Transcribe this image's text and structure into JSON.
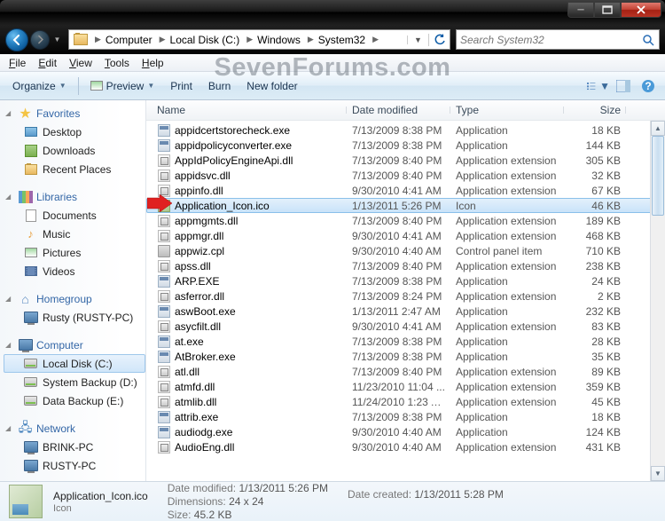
{
  "window": {
    "min": "_",
    "max": "❐",
    "close_title": "Close"
  },
  "nav": {
    "crumbs": [
      "Computer",
      "Local Disk (C:)",
      "Windows",
      "System32"
    ],
    "search_placeholder": "Search System32"
  },
  "menu": {
    "file": "File",
    "edit": "Edit",
    "view": "View",
    "tools": "Tools",
    "help": "Help"
  },
  "watermark": "SevenForums.com",
  "toolbar": {
    "organize": "Organize",
    "preview": "Preview",
    "print": "Print",
    "burn": "Burn",
    "newfolder": "New folder"
  },
  "sidebar": {
    "favorites": {
      "title": "Favorites",
      "items": [
        "Desktop",
        "Downloads",
        "Recent Places"
      ]
    },
    "libraries": {
      "title": "Libraries",
      "items": [
        "Documents",
        "Music",
        "Pictures",
        "Videos"
      ]
    },
    "homegroup": {
      "title": "Homegroup",
      "items": [
        "Rusty (RUSTY-PC)"
      ]
    },
    "computer": {
      "title": "Computer",
      "items": [
        "Local Disk (C:)",
        "System Backup (D:)",
        "Data Backup (E:)"
      ]
    },
    "network": {
      "title": "Network",
      "items": [
        "BRINK-PC",
        "RUSTY-PC"
      ]
    }
  },
  "columns": {
    "name": "Name",
    "date": "Date modified",
    "type": "Type",
    "size": "Size"
  },
  "files": [
    {
      "name": "appidcertstorecheck.exe",
      "date": "7/13/2009 8:38 PM",
      "type": "Application",
      "size": "18 KB",
      "ico": "exe"
    },
    {
      "name": "appidpolicyconverter.exe",
      "date": "7/13/2009 8:38 PM",
      "type": "Application",
      "size": "144 KB",
      "ico": "exe"
    },
    {
      "name": "AppIdPolicyEngineApi.dll",
      "date": "7/13/2009 8:40 PM",
      "type": "Application extension",
      "size": "305 KB",
      "ico": "dll"
    },
    {
      "name": "appidsvc.dll",
      "date": "7/13/2009 8:40 PM",
      "type": "Application extension",
      "size": "32 KB",
      "ico": "dll"
    },
    {
      "name": "appinfo.dll",
      "date": "9/30/2010 4:41 AM",
      "type": "Application extension",
      "size": "67 KB",
      "ico": "dll"
    },
    {
      "name": "Application_Icon.ico",
      "date": "1/13/2011 5:26 PM",
      "type": "Icon",
      "size": "46 KB",
      "ico": "ico",
      "sel": true
    },
    {
      "name": "appmgmts.dll",
      "date": "7/13/2009 8:40 PM",
      "type": "Application extension",
      "size": "189 KB",
      "ico": "dll"
    },
    {
      "name": "appmgr.dll",
      "date": "9/30/2010 4:41 AM",
      "type": "Application extension",
      "size": "468 KB",
      "ico": "dll"
    },
    {
      "name": "appwiz.cpl",
      "date": "9/30/2010 4:40 AM",
      "type": "Control panel item",
      "size": "710 KB",
      "ico": "cpl"
    },
    {
      "name": "apss.dll",
      "date": "7/13/2009 8:40 PM",
      "type": "Application extension",
      "size": "238 KB",
      "ico": "dll"
    },
    {
      "name": "ARP.EXE",
      "date": "7/13/2009 8:38 PM",
      "type": "Application",
      "size": "24 KB",
      "ico": "exe"
    },
    {
      "name": "asferror.dll",
      "date": "7/13/2009 8:24 PM",
      "type": "Application extension",
      "size": "2 KB",
      "ico": "dll"
    },
    {
      "name": "aswBoot.exe",
      "date": "1/13/2011 2:47 AM",
      "type": "Application",
      "size": "232 KB",
      "ico": "exe"
    },
    {
      "name": "asycfilt.dll",
      "date": "9/30/2010 4:41 AM",
      "type": "Application extension",
      "size": "83 KB",
      "ico": "dll"
    },
    {
      "name": "at.exe",
      "date": "7/13/2009 8:38 PM",
      "type": "Application",
      "size": "28 KB",
      "ico": "exe"
    },
    {
      "name": "AtBroker.exe",
      "date": "7/13/2009 8:38 PM",
      "type": "Application",
      "size": "35 KB",
      "ico": "exe"
    },
    {
      "name": "atl.dll",
      "date": "7/13/2009 8:40 PM",
      "type": "Application extension",
      "size": "89 KB",
      "ico": "dll"
    },
    {
      "name": "atmfd.dll",
      "date": "11/23/2010 11:04 ...",
      "type": "Application extension",
      "size": "359 KB",
      "ico": "dll"
    },
    {
      "name": "atmlib.dll",
      "date": "11/24/2010 1:23 AM",
      "type": "Application extension",
      "size": "45 KB",
      "ico": "dll"
    },
    {
      "name": "attrib.exe",
      "date": "7/13/2009 8:38 PM",
      "type": "Application",
      "size": "18 KB",
      "ico": "exe"
    },
    {
      "name": "audiodg.exe",
      "date": "9/30/2010 4:40 AM",
      "type": "Application",
      "size": "124 KB",
      "ico": "exe"
    },
    {
      "name": "AudioEng.dll",
      "date": "9/30/2010 4:40 AM",
      "type": "Application extension",
      "size": "431 KB",
      "ico": "dll"
    }
  ],
  "details": {
    "name": "Application_Icon.ico",
    "type": "Icon",
    "date_modified_k": "Date modified:",
    "date_modified_v": "1/13/2011 5:26 PM",
    "dimensions_k": "Dimensions:",
    "dimensions_v": "24 x 24",
    "size_k": "Size:",
    "size_v": "45.2 KB",
    "date_created_k": "Date created:",
    "date_created_v": "1/13/2011 5:28 PM"
  }
}
